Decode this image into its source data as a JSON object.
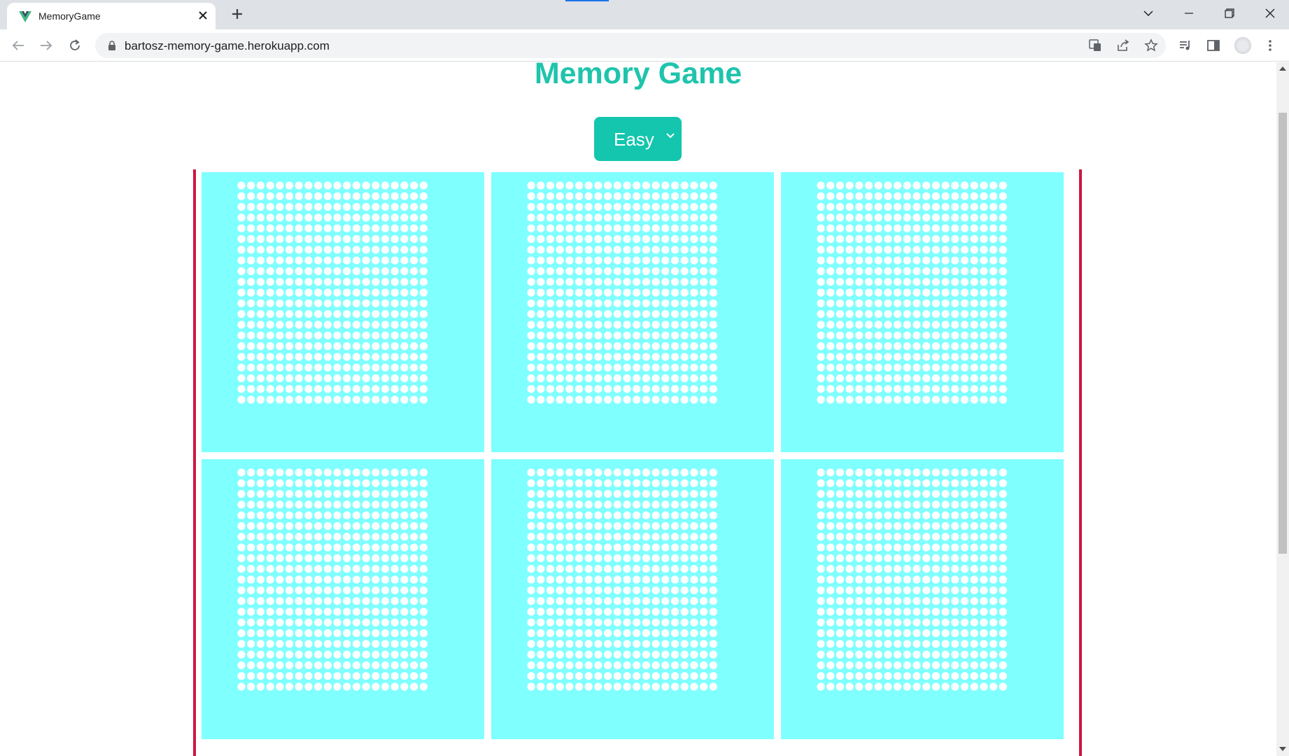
{
  "browser": {
    "tab_title": "MemoryGame",
    "url": "bartosz-memory-game.herokuapp.com",
    "favicon": "vue-logo-icon"
  },
  "page": {
    "title": "Memory Game",
    "difficulty": {
      "selected": "Easy"
    },
    "cards": [
      {
        "id": "card-1",
        "state": "face-down"
      },
      {
        "id": "card-2",
        "state": "face-down"
      },
      {
        "id": "card-3",
        "state": "face-down"
      },
      {
        "id": "card-4",
        "state": "face-down"
      },
      {
        "id": "card-5",
        "state": "face-down"
      },
      {
        "id": "card-6",
        "state": "face-down"
      }
    ]
  },
  "colors": {
    "title": "#1fc4ac",
    "button": "#13c6ad",
    "card": "#80ffff",
    "card_dots": "#ffffff",
    "board_border": "#cf163f"
  }
}
